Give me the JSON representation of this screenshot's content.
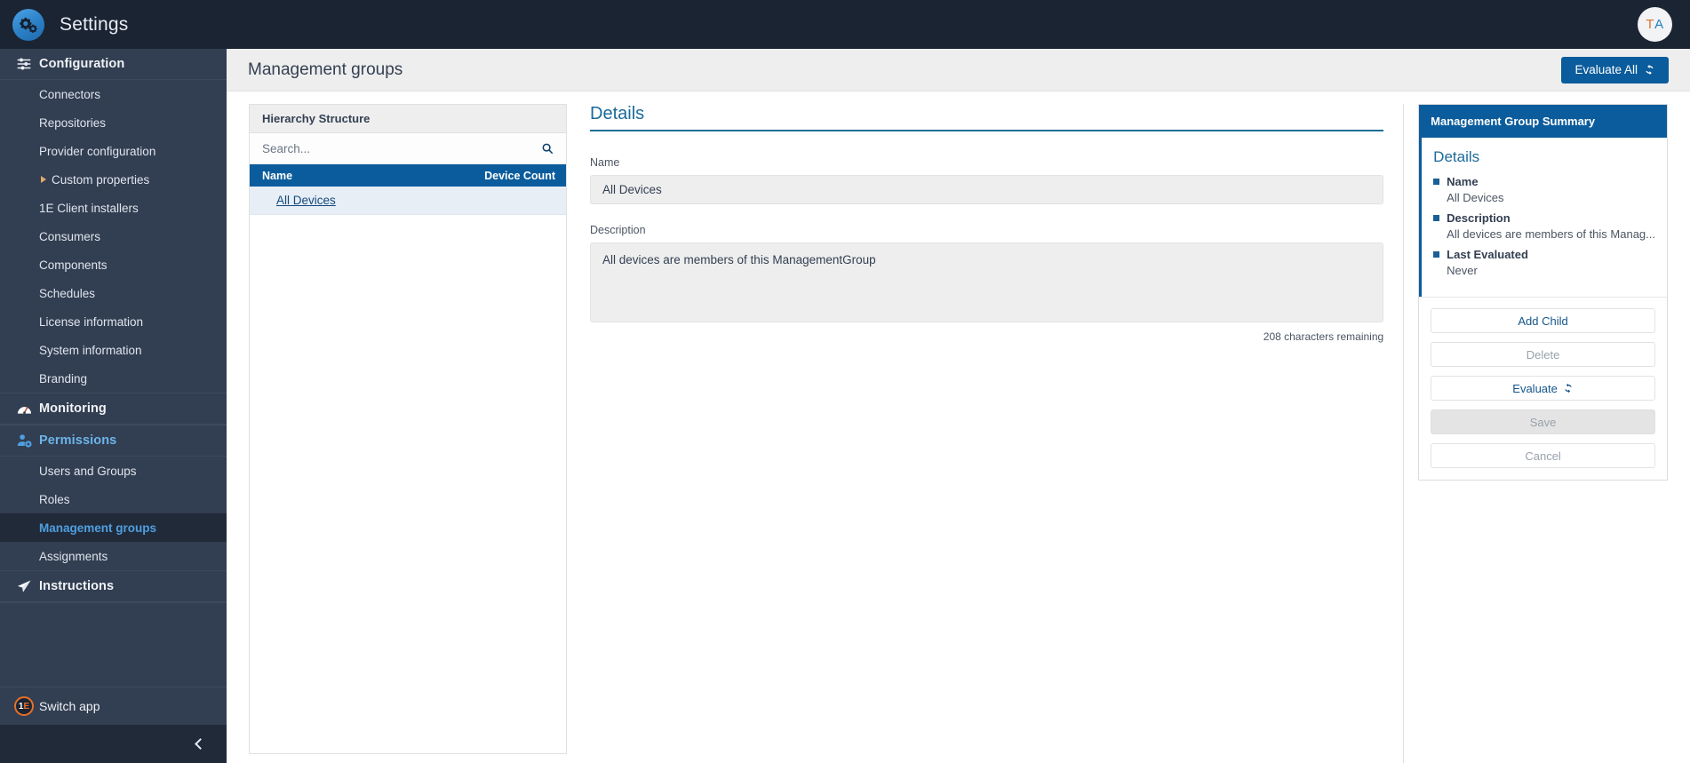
{
  "topbar": {
    "app_title": "Settings",
    "logo_icon": "gears-icon",
    "avatar_initial_1": "T",
    "avatar_initial_2": "A"
  },
  "sidebar": {
    "groups": [
      {
        "label": "Configuration",
        "icon": "sliders-icon",
        "items": [
          {
            "label": "Connectors",
            "caret": false,
            "active": false
          },
          {
            "label": "Repositories",
            "caret": false,
            "active": false
          },
          {
            "label": "Provider configuration",
            "caret": false,
            "active": false
          },
          {
            "label": "Custom properties",
            "caret": true,
            "active": false
          },
          {
            "label": "1E Client installers",
            "caret": false,
            "active": false
          },
          {
            "label": "Consumers",
            "caret": false,
            "active": false
          },
          {
            "label": "Components",
            "caret": false,
            "active": false
          },
          {
            "label": "Schedules",
            "caret": false,
            "active": false
          },
          {
            "label": "License information",
            "caret": false,
            "active": false
          },
          {
            "label": "System information",
            "caret": false,
            "active": false
          },
          {
            "label": "Branding",
            "caret": false,
            "active": false
          }
        ]
      },
      {
        "label": "Monitoring",
        "icon": "gauge-icon",
        "items": []
      },
      {
        "label": "Permissions",
        "icon": "user-gear-icon",
        "accent": true,
        "items": [
          {
            "label": "Users and Groups",
            "caret": false,
            "active": false
          },
          {
            "label": "Roles",
            "caret": false,
            "active": false
          },
          {
            "label": "Management groups",
            "caret": false,
            "active": true
          },
          {
            "label": "Assignments",
            "caret": false,
            "active": false
          }
        ]
      },
      {
        "label": "Instructions",
        "icon": "paper-plane-icon",
        "items": []
      }
    ],
    "switch_app": {
      "label": "Switch app",
      "icon": "1e-logo-icon"
    },
    "collapse_icon": "chevron-left-icon"
  },
  "page": {
    "title": "Management groups",
    "evaluate_all_label": "Evaluate All",
    "evaluate_all_icon": "refresh-icon"
  },
  "hierarchy": {
    "panel_title": "Hierarchy Structure",
    "search_placeholder": "Search...",
    "search_value": "",
    "search_icon": "search-icon",
    "columns": {
      "name": "Name",
      "device_count": "Device Count"
    },
    "rows": [
      {
        "name": "All Devices",
        "device_count": ""
      }
    ]
  },
  "details": {
    "heading": "Details",
    "name_label": "Name",
    "name_value": "All Devices",
    "description_label": "Description",
    "description_value": "All devices are members of this ManagementGroup",
    "chars_remaining": "208 characters remaining"
  },
  "summary": {
    "header": "Management Group Summary",
    "title": "Details",
    "fields": [
      {
        "key": "Name",
        "value": "All Devices"
      },
      {
        "key": "Description",
        "value": "All devices are members of this Manag..."
      },
      {
        "key": "Last Evaluated",
        "value": "Never"
      }
    ],
    "actions": [
      {
        "label": "Add Child",
        "state": "enabled",
        "icon": ""
      },
      {
        "label": "Delete",
        "state": "disabled",
        "icon": ""
      },
      {
        "label": "Evaluate",
        "state": "enabled",
        "icon": "refresh-icon"
      },
      {
        "label": "Save",
        "state": "filled-disabled",
        "icon": ""
      },
      {
        "label": "Cancel",
        "state": "disabled",
        "icon": ""
      }
    ]
  },
  "colors": {
    "sidebar_bg": "#323e51",
    "topbar_bg": "#1b2433",
    "accent_blue": "#0b5c9c",
    "link_blue": "#134a7c",
    "heading_teal": "#1a6a9a"
  }
}
